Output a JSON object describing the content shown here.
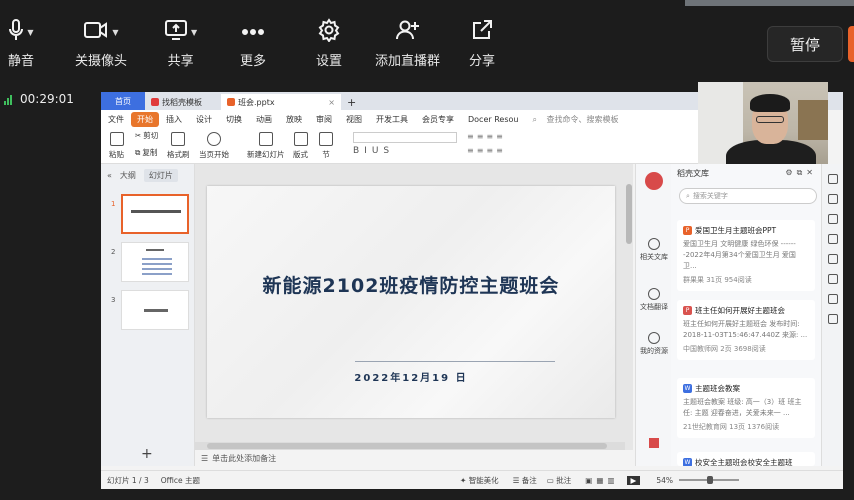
{
  "meeting_toolbar": {
    "buttons": [
      {
        "label": "静音",
        "icon": "microphone-icon"
      },
      {
        "label": "关摄像头",
        "icon": "camera-icon"
      },
      {
        "label": "共享",
        "icon": "share-screen-icon"
      },
      {
        "label": "更多",
        "icon": "more-icon"
      },
      {
        "label": "设置",
        "icon": "settings-icon"
      },
      {
        "label": "添加直播群",
        "icon": "add-group-icon"
      },
      {
        "label": "分享",
        "icon": "share-icon"
      }
    ],
    "pause_label": "暂停",
    "accent_color": "#e8622a"
  },
  "timer": {
    "elapsed": "00:29:01"
  },
  "wps": {
    "tabs": {
      "home": "首页",
      "find": "找稻壳模板",
      "doc": "班会.pptx"
    },
    "menu": [
      "文件",
      "开始",
      "插入",
      "设计",
      "切换",
      "动画",
      "放映",
      "审阅",
      "视图",
      "开发工具",
      "会员专享",
      "Docer Resou"
    ],
    "search_placeholder": "查找命令、搜索模板",
    "tools": [
      "粘贴",
      "剪切",
      "复制",
      "格式刷",
      "当页开始",
      "新建幻灯片",
      "版式",
      "节"
    ],
    "left_tabs": {
      "outline": "大纲",
      "slides": "幻灯片"
    },
    "slide_numbers": [
      "1",
      "2",
      "3"
    ],
    "slide": {
      "title": "新能源2102班疫情防控主题班会",
      "date": "2022年12月19 日"
    },
    "notes_placeholder": "单击此处添加备注",
    "icon_strip": [
      "相关文库",
      "文档翻译",
      "我的资源"
    ],
    "right_panel": {
      "title": "稻壳文库",
      "search_placeholder": "搜索关键字",
      "cards": [
        {
          "title": "爱国卫生月主题班会PPT",
          "badge": "P",
          "badge_color": "#e8622a",
          "desc": "爱国卫生月 文明健康 绿色环保 ------ -2022年4月第34个爱国卫生月 爱国卫...",
          "meta": "群果果   31页   954阅读"
        },
        {
          "title": "班主任如何开展好主题班会",
          "badge": "P",
          "badge_color": "#d9534f",
          "desc": "班主任如何开展好主题班会 发布时间: 2018-11-03T15:46:47.440Z 来源: ...",
          "meta": "中国教师网   2页   3698阅读"
        },
        {
          "title": "主题班会教案",
          "badge": "W",
          "badge_color": "#3d6fe0",
          "desc": "主题班会教案 班级: 高一（3）班 班主任: 主题 迎春奋进，关爱未来一 ...",
          "meta": "21世纪教育网   13页   1376阅读"
        },
        {
          "title": "校安全主题班会校安全主题班",
          "badge": "W",
          "badge_color": "#3d6fe0",
          "desc": "",
          "meta": ""
        }
      ]
    },
    "status": {
      "slide_count": "幻灯片 1 / 3",
      "theme": "Office 主题",
      "beautify": "智能美化",
      "notes": "备注",
      "comments": "批注",
      "zoom": "54%"
    }
  }
}
